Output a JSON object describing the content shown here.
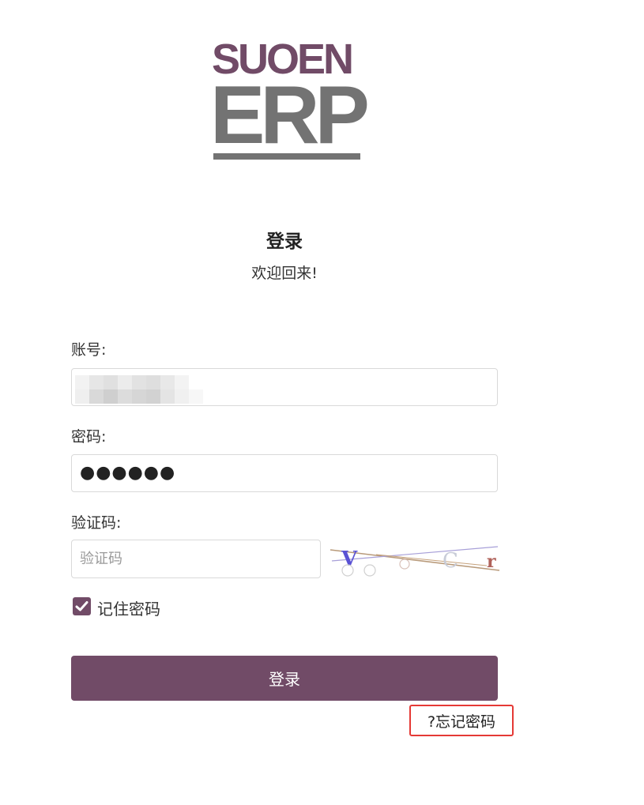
{
  "logo": {
    "brand_line": "SUOEN",
    "product_line": "ERP"
  },
  "heading": {
    "title": "登录",
    "subtitle": "欢迎回来!"
  },
  "form": {
    "account_label": "账号:",
    "account_value": "",
    "password_label": "密码:",
    "password_value": "●●●●●●",
    "captcha_label": "验证码:",
    "captcha_placeholder": "验证码",
    "captcha_image_text": "V   C r",
    "remember_label": "记住密码",
    "remember_checked": true
  },
  "actions": {
    "login_label": "登录",
    "forgot_label": "?忘记密码"
  },
  "colors": {
    "brand": "#714B67",
    "logo_gray": "#737373",
    "highlight": "#e53935"
  }
}
